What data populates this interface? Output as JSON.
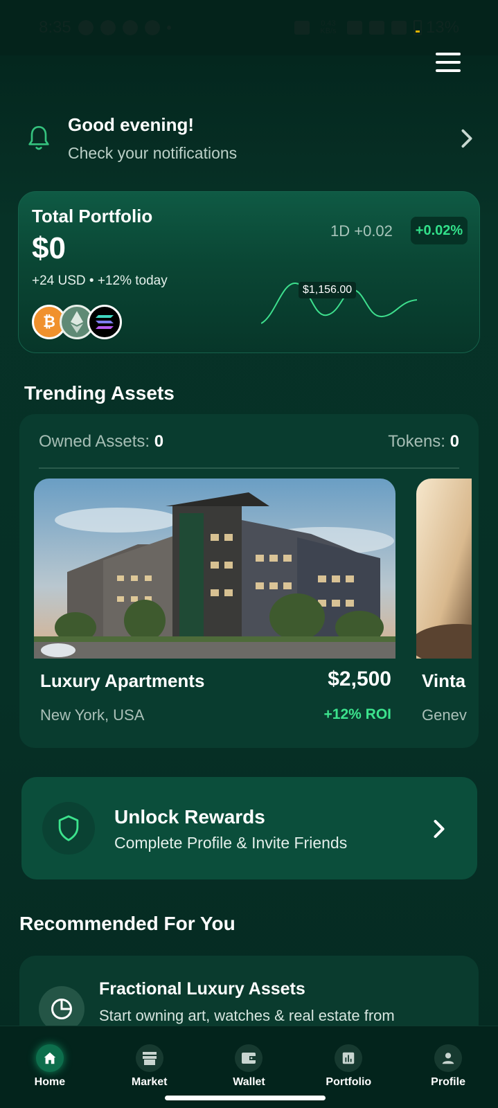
{
  "status_bar": {
    "time": "8:35",
    "network_speed": "0.43 KB/s",
    "battery": "13%"
  },
  "greeting": {
    "title": "Good evening!",
    "subtitle": "Check your notifications"
  },
  "portfolio": {
    "title": "Total Portfolio",
    "value": "$0",
    "change": "+24 USD • +12% today",
    "period_label": "1D +0.02",
    "badge": "+0.02%",
    "sparkline_label": "$1,156.00",
    "coins": [
      "bitcoin-icon",
      "ethereum-icon",
      "solana-icon"
    ],
    "coin_btc_symbol": "₿"
  },
  "trending": {
    "title": "Trending Assets",
    "owned_label": "Owned Assets: ",
    "owned_value": "0",
    "tokens_label": "Tokens: ",
    "tokens_value": "0",
    "assets": [
      {
        "name": "Luxury Apartments",
        "location": "New York, USA",
        "price": "$2,500",
        "roi": "+12% ROI"
      },
      {
        "name": "Vinta",
        "location": "Genev"
      }
    ]
  },
  "rewards": {
    "title": "Unlock Rewards",
    "subtitle": "Complete Profile & Invite Friends"
  },
  "recommended": {
    "title": "Recommended For You",
    "card_title": "Fractional Luxury Assets",
    "card_subtitle": "Start owning art, watches & real estate from"
  },
  "nav": {
    "items": [
      {
        "label": "Home",
        "icon": "home-icon",
        "active": true
      },
      {
        "label": "Market",
        "icon": "store-icon",
        "active": false
      },
      {
        "label": "Wallet",
        "icon": "wallet-icon",
        "active": false
      },
      {
        "label": "Portfolio",
        "icon": "chart-icon",
        "active": false
      },
      {
        "label": "Profile",
        "icon": "user-icon",
        "active": false
      }
    ]
  },
  "colors": {
    "accent": "#3ce38d",
    "background": "#063026",
    "card": "#093c2f"
  }
}
